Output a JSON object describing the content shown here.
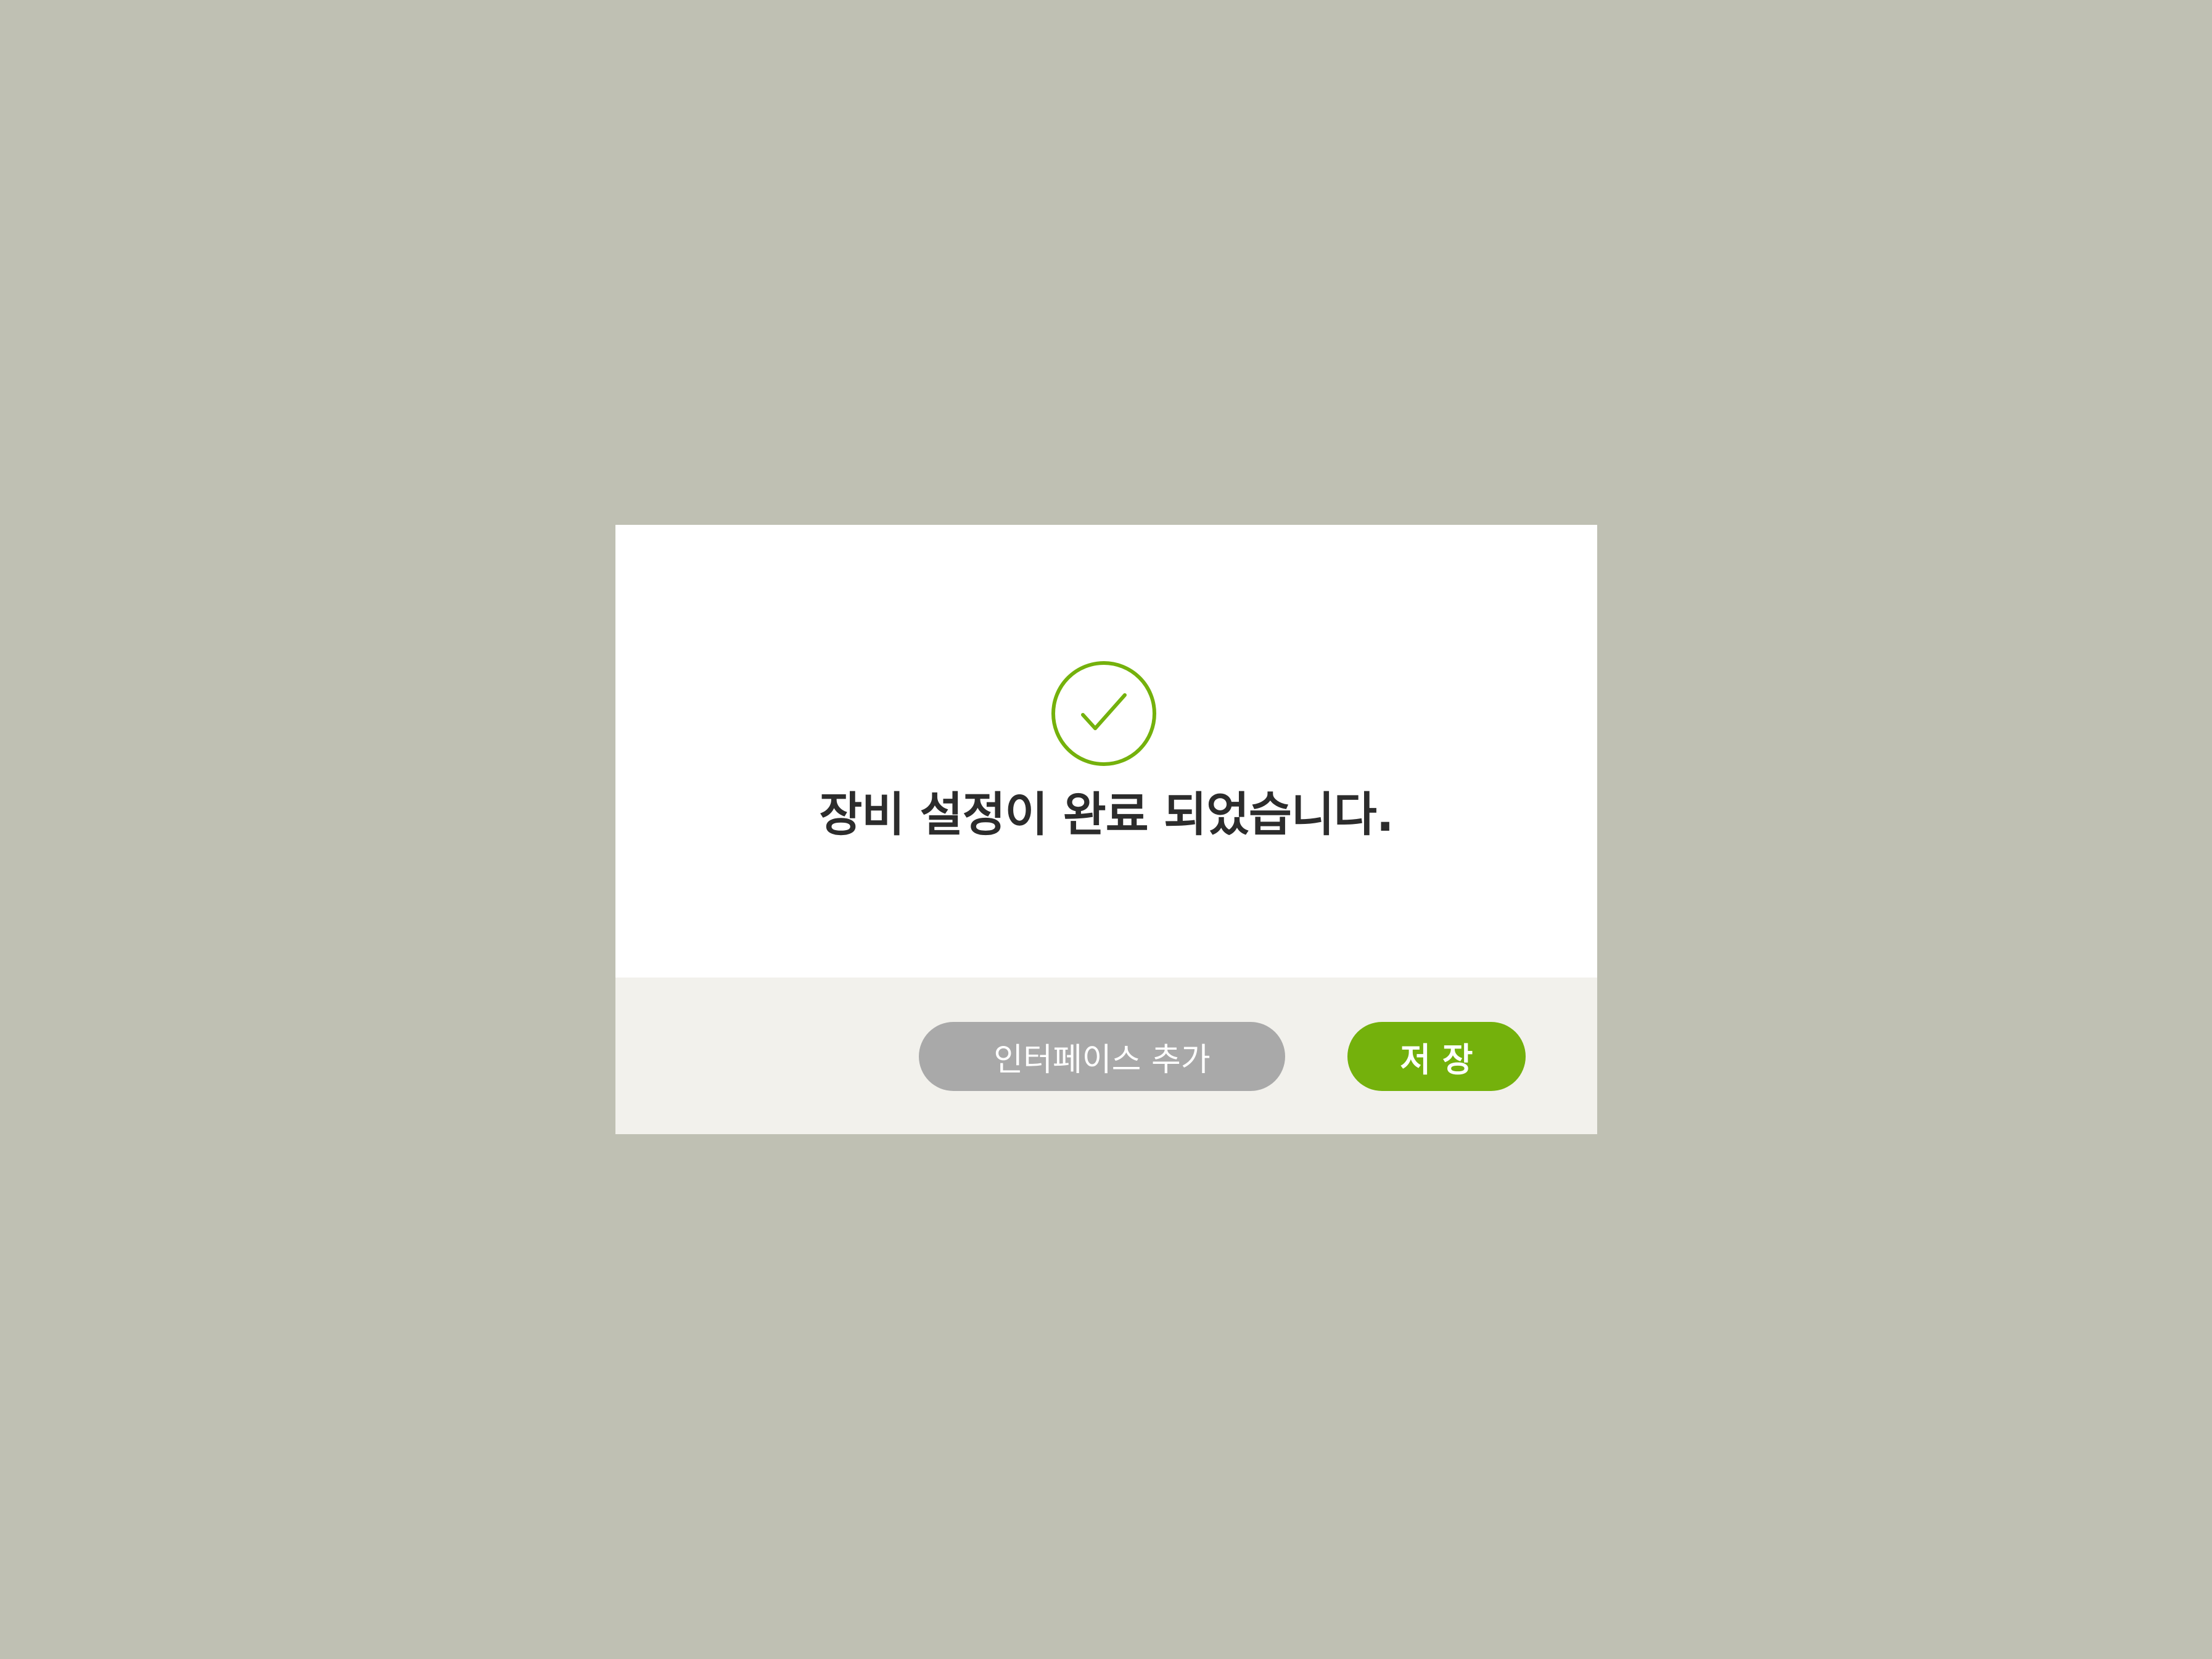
{
  "dialog": {
    "icon": "check-circle-icon",
    "message": "장비 설정이 완료 되었습니다.",
    "buttons": {
      "add_interface_label": "인터페이스 추가",
      "save_label": "저 장"
    }
  },
  "colors": {
    "backdrop": "#bfc0b3",
    "accent": "#74b10c",
    "secondary_button": "#a9a9a9",
    "footer": "#f2f1ec",
    "text": "#2c2c2c"
  }
}
